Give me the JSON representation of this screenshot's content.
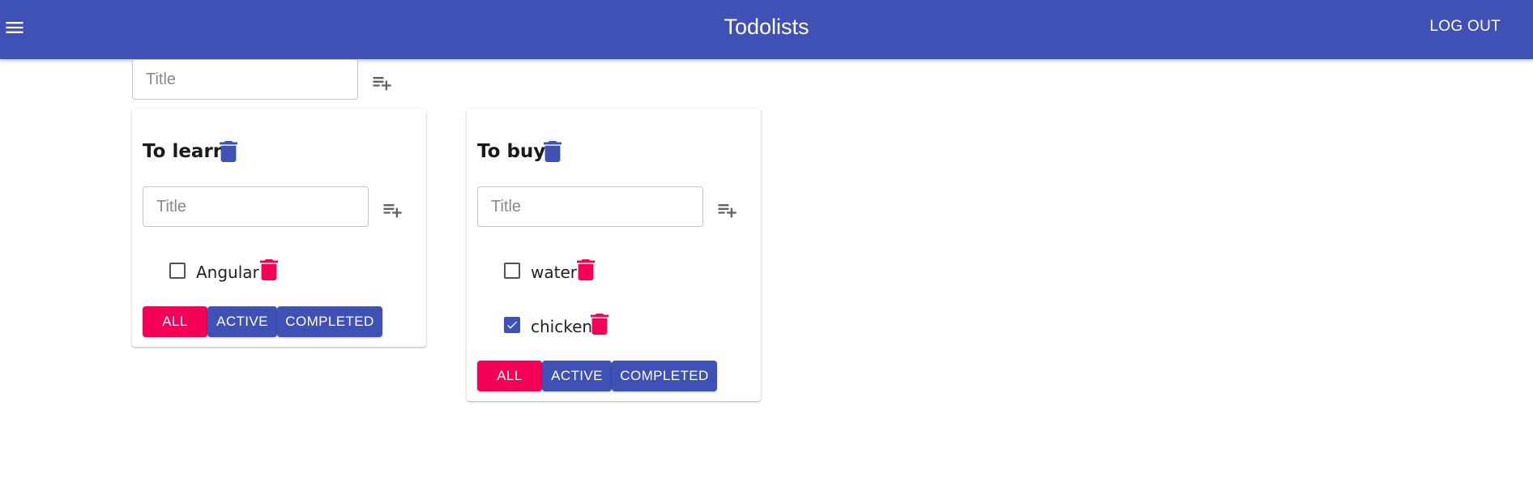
{
  "appbar": {
    "title": "Todolists",
    "logout_label": "LOG OUT",
    "menu_icon": "menu-icon"
  },
  "new_list": {
    "placeholder": "Title",
    "add_icon": "playlist-add-icon"
  },
  "colors": {
    "primary": "#3f51b5",
    "secondary": "#f50057"
  },
  "todolists": [
    {
      "title": "To learn",
      "add_placeholder": "Title",
      "tasks": [
        {
          "title": "Angular",
          "done": false
        }
      ],
      "filters": {
        "all": "ALL",
        "active": "ACTIVE",
        "completed": "COMPLETED"
      },
      "active_filter": "all"
    },
    {
      "title": "To buy",
      "add_placeholder": "Title",
      "tasks": [
        {
          "title": "water",
          "done": false
        },
        {
          "title": "chicken",
          "done": true
        }
      ],
      "filters": {
        "all": "ALL",
        "active": "ACTIVE",
        "completed": "COMPLETED"
      },
      "active_filter": "all"
    }
  ]
}
